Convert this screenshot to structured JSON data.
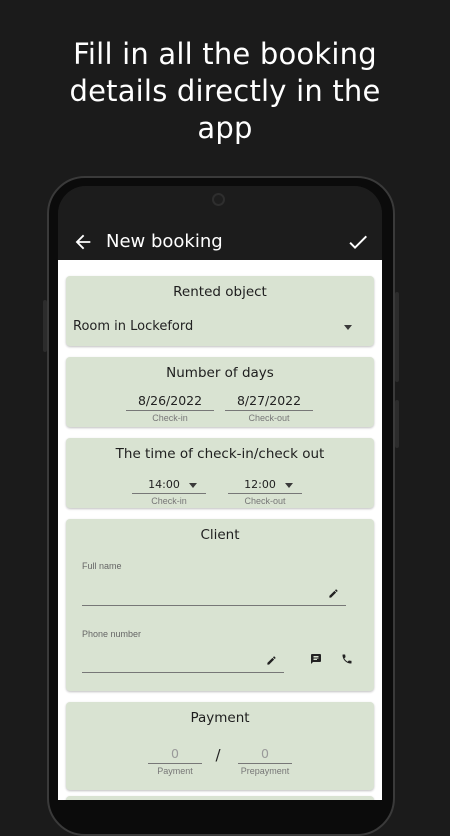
{
  "promo": {
    "line1": "Fill in all the booking",
    "line2": "details directly in the",
    "line3": "app"
  },
  "appbar": {
    "title": "New booking",
    "back_icon": "arrow-back-icon",
    "save_icon": "check-icon"
  },
  "rented_object": {
    "title": "Rented object",
    "value": "Room in Lockeford"
  },
  "number_of_days": {
    "title": "Number of days",
    "check_in_date": "8/26/2022",
    "check_in_caption": "Check-in",
    "check_out_date": "8/27/2022",
    "check_out_caption": "Check-out"
  },
  "check_times": {
    "title": "The time of check-in/check out",
    "check_in_time": "14:00",
    "check_in_caption": "Check-in",
    "check_out_time": "12:00",
    "check_out_caption": "Check-out"
  },
  "client": {
    "title": "Client",
    "full_name_label": "Full name",
    "full_name_value": "",
    "phone_label": "Phone number",
    "phone_value": ""
  },
  "payment": {
    "title": "Payment",
    "payment_value": "0",
    "payment_caption": "Payment",
    "separator": "/",
    "prepayment_value": "0",
    "prepayment_caption": "Prepayment"
  },
  "colors": {
    "background": "#1b1b1b",
    "card": "#d9e3d2",
    "content": "#ffffff"
  }
}
